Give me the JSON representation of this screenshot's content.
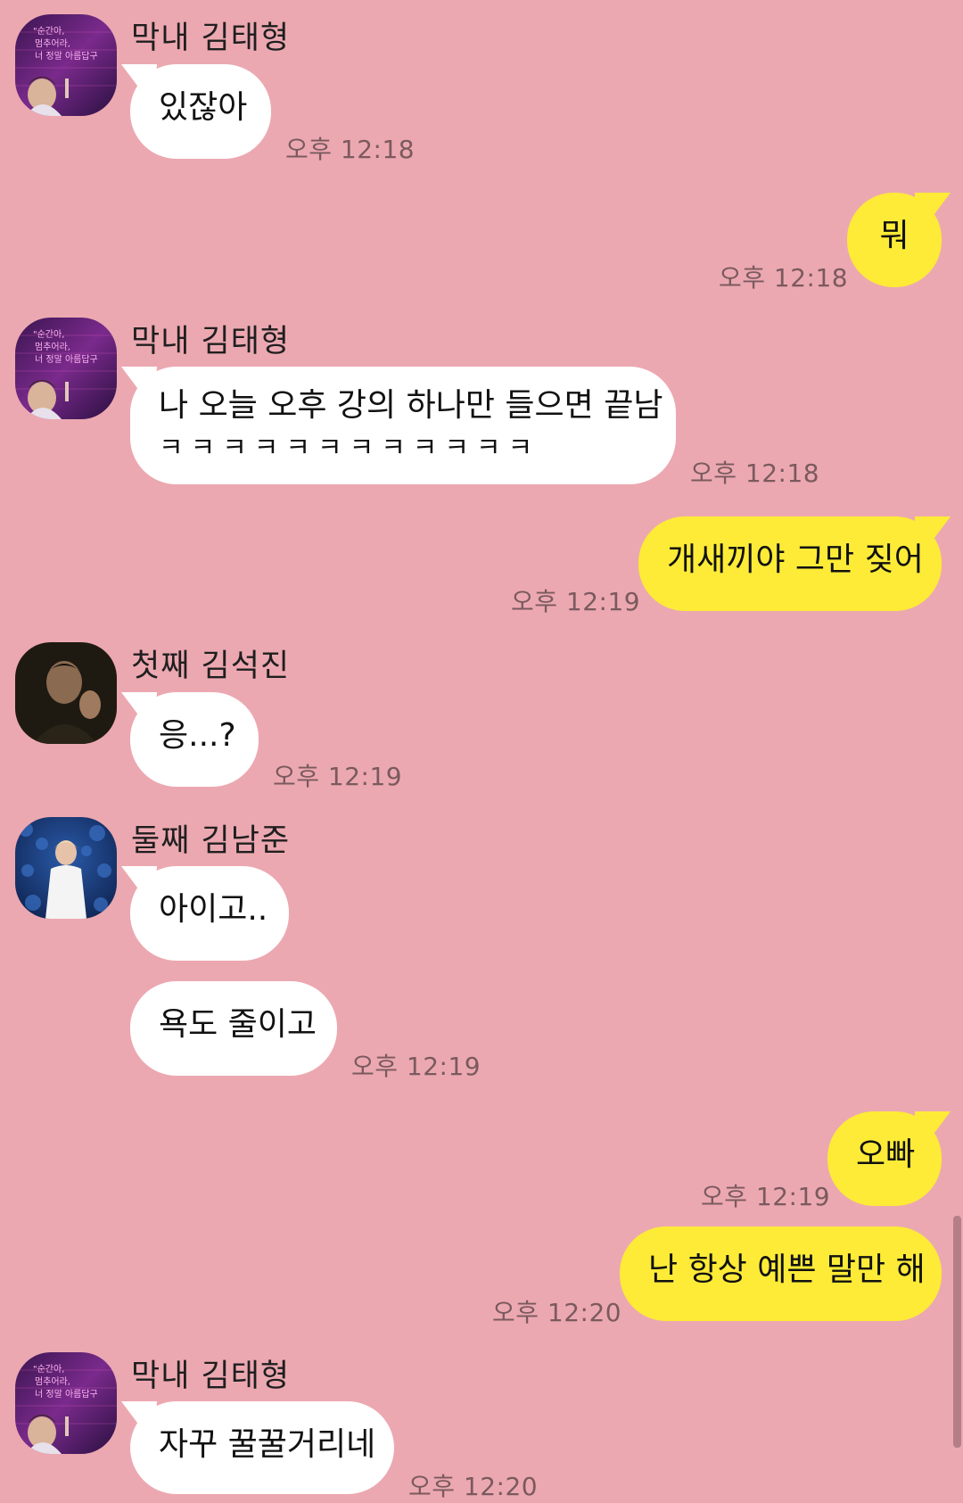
{
  "contacts": {
    "taehyung": "막내 김태형",
    "seokjin": "첫째 김석진",
    "namjoon": "둘째 김남준"
  },
  "avatar_text": {
    "line1": "\"순간아,",
    "line2": "멈추어라,",
    "line3": "너 정말 아름답구"
  },
  "messages": [
    {
      "from": "taehyung",
      "text": "있잖아",
      "time": "오후 12:18"
    },
    {
      "from": "me",
      "text": "뭐",
      "time": "오후 12:18"
    },
    {
      "from": "taehyung",
      "text": "나 오늘 오후 강의 하나만 들으면 끝남",
      "text2": "ㅋㅋㅋㅋㅋㅋㅋㅋㅋㅋㅋㅋ",
      "time": "오후 12:18"
    },
    {
      "from": "me",
      "text": "개새끼야 그만 짖어",
      "time": "오후 12:19"
    },
    {
      "from": "seokjin",
      "text": "응...?",
      "time": "오후 12:19"
    },
    {
      "from": "namjoon",
      "text": "아이고..",
      "time": ""
    },
    {
      "from": "namjoon",
      "text": "욕도 줄이고",
      "time": "오후 12:19"
    },
    {
      "from": "me",
      "text": "오빠",
      "time": "오후 12:19"
    },
    {
      "from": "me",
      "text": "난 항상 예쁜 말만 해",
      "time": "오후 12:20"
    },
    {
      "from": "taehyung",
      "text": "자꾸 꿀꿀거리네",
      "time": "오후 12:20"
    }
  ],
  "colors": {
    "background": "#eca8b1",
    "incoming_bubble": "#ffffff",
    "outgoing_bubble": "#fdeb37",
    "time_text": "#7a5a5e"
  }
}
